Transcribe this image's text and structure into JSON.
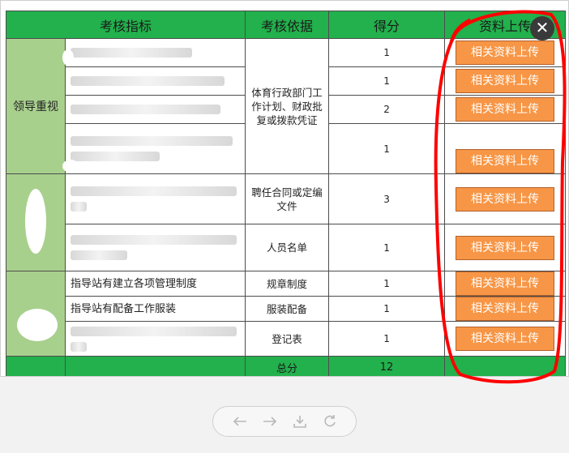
{
  "headers": {
    "indicator": "考核指标",
    "basis": "考核依据",
    "score": "得分",
    "upload": "资料上传"
  },
  "categories": {
    "leadership": "领导重视"
  },
  "rows": [
    {
      "indicator": "",
      "score": "1",
      "upload_label": "相关资料上传"
    },
    {
      "indicator": "",
      "score": "1",
      "upload_label": "相关资料上传"
    },
    {
      "indicator": "",
      "score": "2",
      "upload_label": "相关资料上传"
    },
    {
      "indicator": "",
      "score": "1",
      "upload_label": "相关资料上传"
    },
    {
      "indicator": "",
      "basis": "聘任合同或定编文件",
      "score": "3",
      "upload_label": "相关资料上传"
    },
    {
      "indicator": "",
      "basis": "人员名单",
      "score": "1",
      "upload_label": "相关资料上传"
    },
    {
      "indicator": "指导站有建立各项管理制度",
      "basis": "规章制度",
      "score": "1",
      "upload_label": "相关资料上传"
    },
    {
      "indicator": "指导站有配备工作服装",
      "basis": "服装配备",
      "score": "1",
      "upload_label": "相关资料上传"
    },
    {
      "indicator": "",
      "basis": "登记表",
      "score": "1",
      "upload_label": "相关资料上传"
    }
  ],
  "group1_basis": "体育行政部门工作计划、财政批复或拨款凭证",
  "total": {
    "label": "总分",
    "value": "12"
  },
  "colors": {
    "header_green": "#22b14c",
    "category_green": "#a8d08d",
    "button_orange": "#f79646",
    "annotation_red": "#ff0000"
  },
  "icons": {
    "close": "close-icon",
    "back": "arrow-left-icon",
    "forward": "arrow-right-icon",
    "download": "download-icon",
    "refresh": "refresh-icon"
  }
}
